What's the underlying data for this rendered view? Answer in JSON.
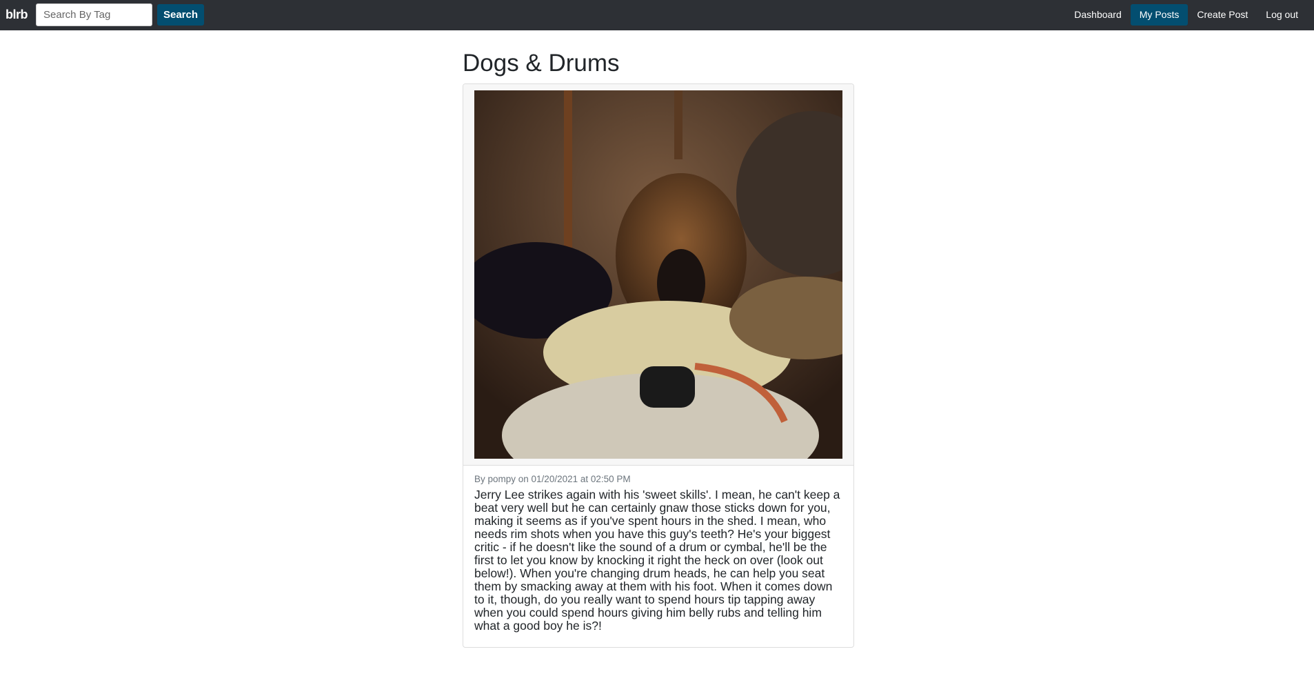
{
  "nav": {
    "brand": "blrb",
    "search_placeholder": "Search By Tag",
    "search_label": "Search",
    "links": [
      "Dashboard",
      "My Posts",
      "Create Post",
      "Log out"
    ],
    "active": "My Posts"
  },
  "post": {
    "title": "Dogs & Drums",
    "meta": "By pompy on 01/20/2021 at 02:50 PM",
    "body": "Jerry Lee strikes again with his 'sweet skills'. I mean, he can't keep a beat very well but he can certainly gnaw those sticks down for you, making it seems as if you've spent hours in the shed. I mean, who needs rim shots when you have this guy's teeth? He's your biggest critic - if he doesn't like the sound of a drum or cymbal, he'll be the first to let you know by knocking it right the heck on over (look out below!). When you're changing drum heads, he can help you seat them by smacking away at them with his foot. When it comes down to it, though, do you really want to spend hours tip tapping away when you could spend hours giving him belly rubs and telling him what a good boy he is?!"
  }
}
